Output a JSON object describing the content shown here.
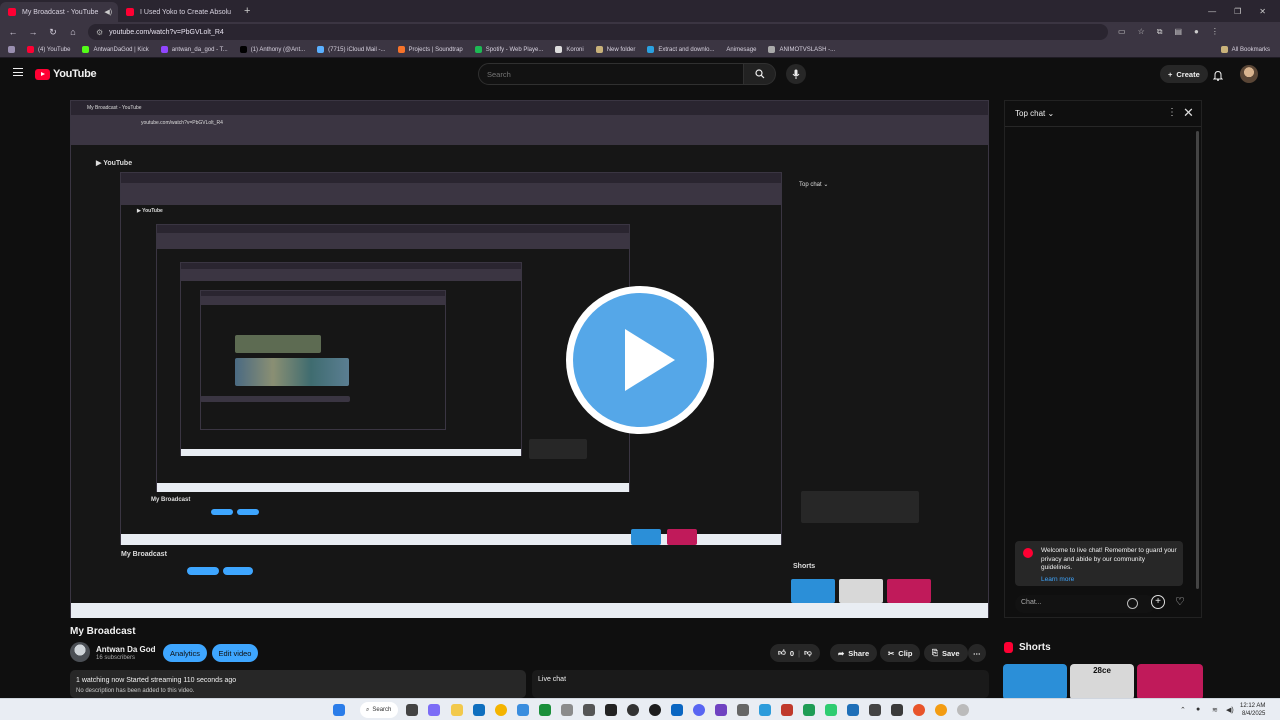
{
  "browser": {
    "tabs": [
      {
        "title": "My Broadcast - YouTube",
        "active": true
      },
      {
        "title": "I Used Yoko to Create Absolu",
        "active": false
      }
    ],
    "url": "youtube.com/watch?v=PbGVLolt_R4",
    "bookmarks": [
      "(4) YouTube",
      "AntwanDaGod | Kick",
      "antwan_da_god - T...",
      "(1) Anthony (@Ant...",
      "(7715) iCloud Mail -...",
      "Projects | Soundtrap",
      "Spotify - Web Playe...",
      "Koroni",
      "New folder",
      "Extract and downlo...",
      "Animesage",
      "ANIMOTVSLASH -..."
    ],
    "all_bookmarks": "All Bookmarks"
  },
  "youtube": {
    "logo_text": "YouTube",
    "search_placeholder": "Search",
    "create_label": "Create"
  },
  "chat": {
    "title": "Top chat",
    "welcome": "Welcome to live chat! Remember to guard your privacy and abide by our community guidelines.",
    "learn_more": "Learn more",
    "input_placeholder": "Chat..."
  },
  "video": {
    "title": "My Broadcast",
    "channel": "Antwan Da God",
    "subscribers": "16 subscribers",
    "analytics": "Analytics",
    "edit_video": "Edit video",
    "likes": "0",
    "share": "Share",
    "clip": "Clip",
    "save": "Save",
    "watching": "1 watching now  Started streaming 110 seconds ago",
    "description": "No description has been added to this video.",
    "live_chat_label": "Live chat"
  },
  "shorts": {
    "title": "Shorts",
    "items": [
      {
        "color": "#2b8fd8",
        "label": ""
      },
      {
        "color": "#d8d8d8",
        "label": "28ce"
      },
      {
        "color": "#c01a5a",
        "label": ""
      }
    ]
  },
  "taskbar": {
    "search_label": "Search",
    "time": "12:12 AM",
    "date": "8/4/2025"
  },
  "colors": {
    "accent": "#3ea6ff",
    "brand": "#ff0033",
    "play_button": "#55a7e8"
  }
}
